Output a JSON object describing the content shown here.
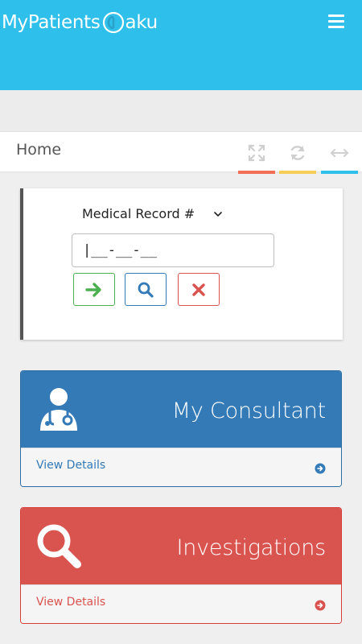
{
  "header": {
    "brand_left": "MyPatients",
    "brand_right": "aku",
    "bg_color": "#2ec0ea",
    "menu_icon": "hamburger-icon"
  },
  "breadcrumb": {
    "title": "Home",
    "tools": [
      {
        "icon": "expand-icon",
        "color": "#f26f55"
      },
      {
        "icon": "refresh-icon",
        "color": "#f7ce5a"
      },
      {
        "icon": "resize-horizontal-icon",
        "color": "#2ec0ea"
      }
    ]
  },
  "search_card": {
    "select_label": "Medical Record #",
    "input_value": "|__-__-__",
    "buttons": {
      "go": {
        "icon": "arrow-right-icon",
        "color": "#4caf50"
      },
      "search": {
        "icon": "search-icon",
        "color": "#337ab7"
      },
      "clear": {
        "icon": "close-icon",
        "color": "#d9534f"
      }
    }
  },
  "panels": [
    {
      "title": "My Consultant",
      "link": "View Details",
      "icon": "doctor-icon",
      "color": "#337ab7"
    },
    {
      "title": "Investigations",
      "link": "View Details",
      "icon": "search-icon",
      "color": "#d9534f"
    }
  ]
}
